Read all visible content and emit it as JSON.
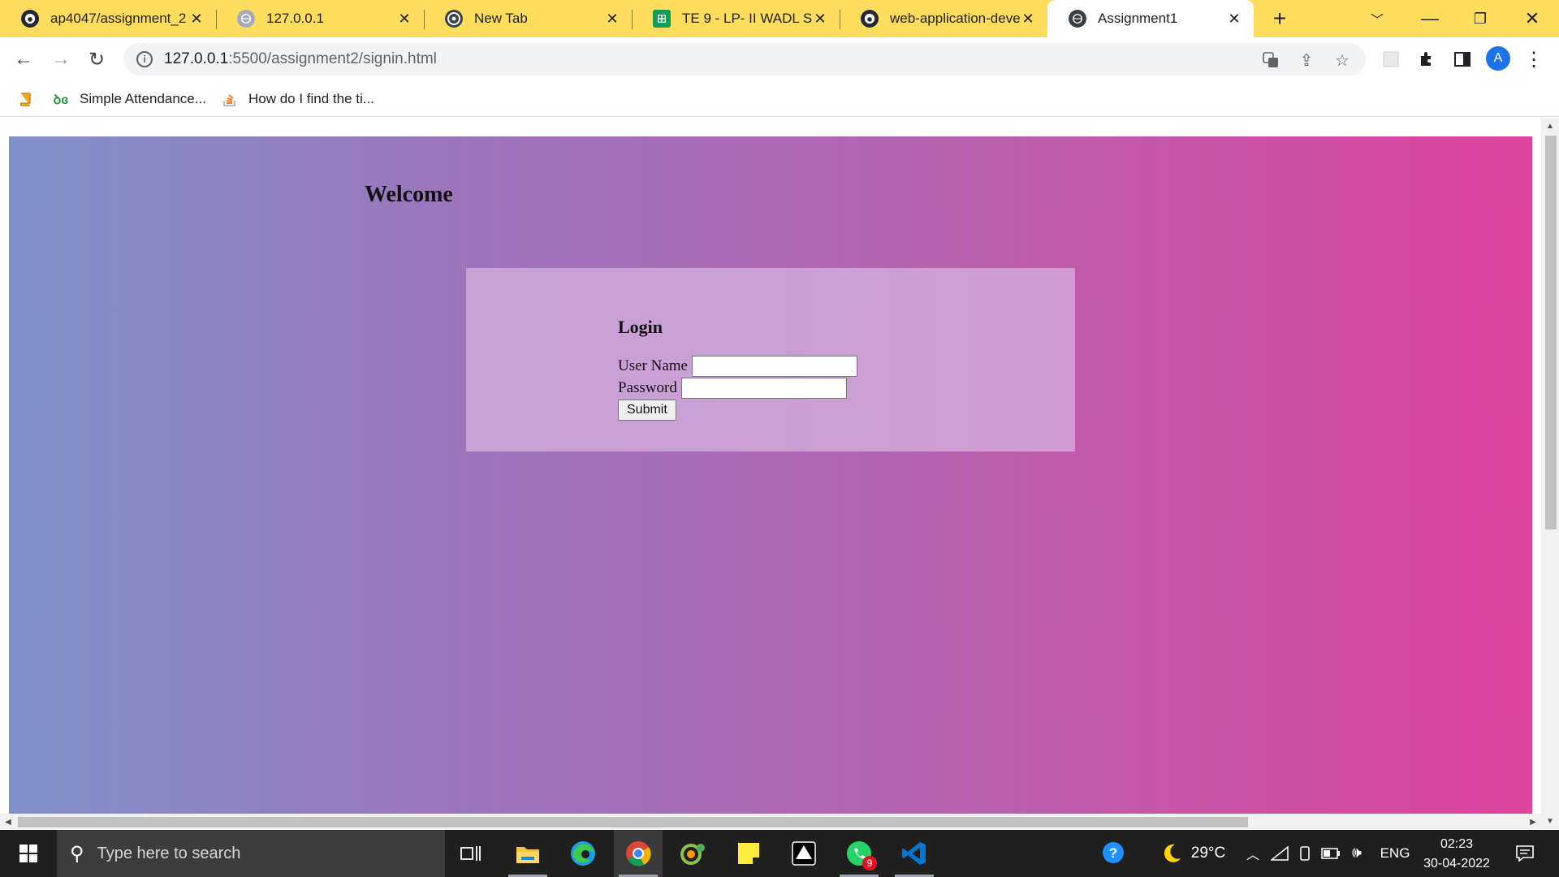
{
  "browser": {
    "tabs": [
      {
        "title": "ap4047/assignment_2",
        "icon": "github-icon",
        "active": false
      },
      {
        "title": "127.0.0.1",
        "icon": "globe-icon",
        "active": false
      },
      {
        "title": "New Tab",
        "icon": "chrome-icon",
        "active": false
      },
      {
        "title": "TE 9 - LP- II WADL Sub",
        "icon": "sheets-icon",
        "active": false
      },
      {
        "title": "web-application-devel",
        "icon": "github-icon",
        "active": false
      },
      {
        "title": "Assignment1",
        "icon": "globe-icon",
        "active": true
      }
    ],
    "address": {
      "host": "127.0.0.1",
      "path": ":5500/assignment2/signin.html"
    },
    "profile_initial": "A",
    "bookmarks": [
      {
        "label": "",
        "icon": "book-icon"
      },
      {
        "label": "Simple Attendance...",
        "icon": "geeks-icon"
      },
      {
        "label": "How do I find the ti...",
        "icon": "stackoverflow-icon"
      }
    ]
  },
  "page": {
    "heading": "Welcome",
    "login": {
      "title": "Login",
      "username_label": "User Name",
      "username_value": "",
      "password_label": "Password",
      "password_value": "",
      "submit_label": "Submit"
    }
  },
  "taskbar": {
    "search_placeholder": "Type here to search",
    "whatsapp_badge": "9",
    "weather": "29°C",
    "language": "ENG",
    "time": "02:23",
    "date": "30-04-2022"
  },
  "colors": {
    "tabstrip": "#fedd5e",
    "gradient_left": "#7f90c8",
    "gradient_right": "#de43a0",
    "login_box": "#d5b4e1"
  }
}
